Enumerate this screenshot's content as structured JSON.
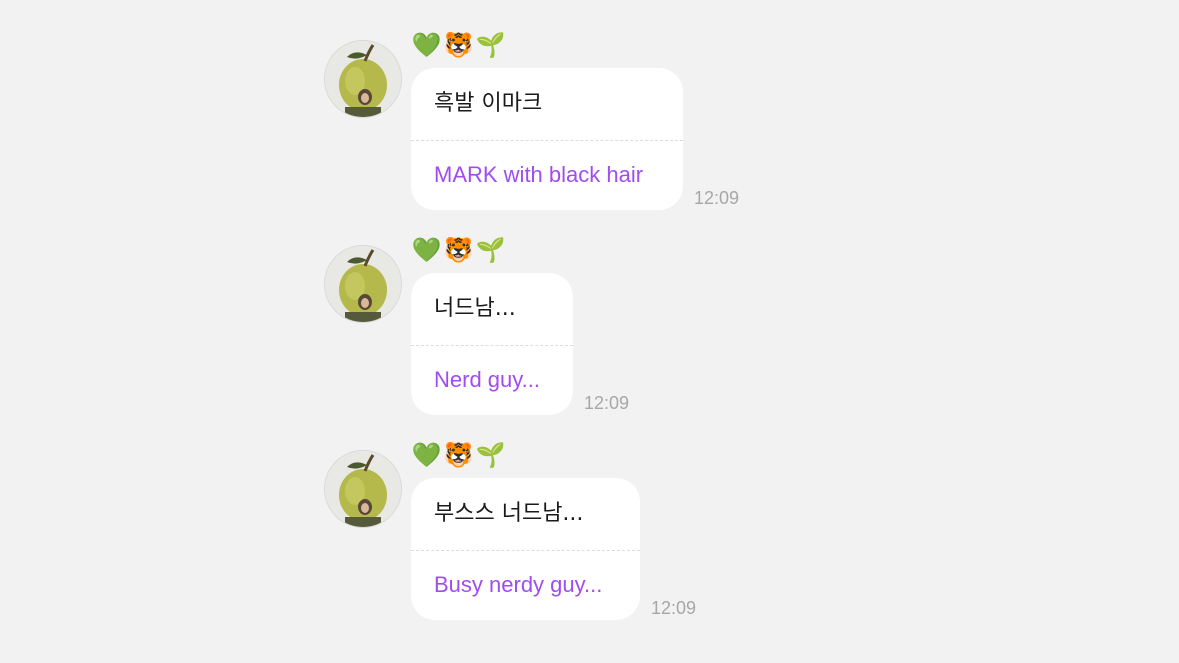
{
  "sender": {
    "name_emojis": [
      "💚",
      "🐯",
      "🌱"
    ]
  },
  "messages": [
    {
      "original": "흑발 이마크",
      "translation": "MARK with black hair",
      "time": "12:09"
    },
    {
      "original": "너드남...",
      "translation": "Nerd guy...",
      "time": "12:09"
    },
    {
      "original": "부스스 너드남...",
      "translation": "Busy nerdy guy...",
      "time": "12:09"
    }
  ],
  "colors": {
    "background": "#f2f2f2",
    "bubble": "#ffffff",
    "translation_text": "#a04df0",
    "timestamp": "#a7a7a7"
  },
  "icons": {
    "avatar": "green-apple-avatar",
    "name_emoji_1": "green-heart-icon",
    "name_emoji_2": "tiger-face-icon",
    "name_emoji_3": "seedling-icon"
  }
}
